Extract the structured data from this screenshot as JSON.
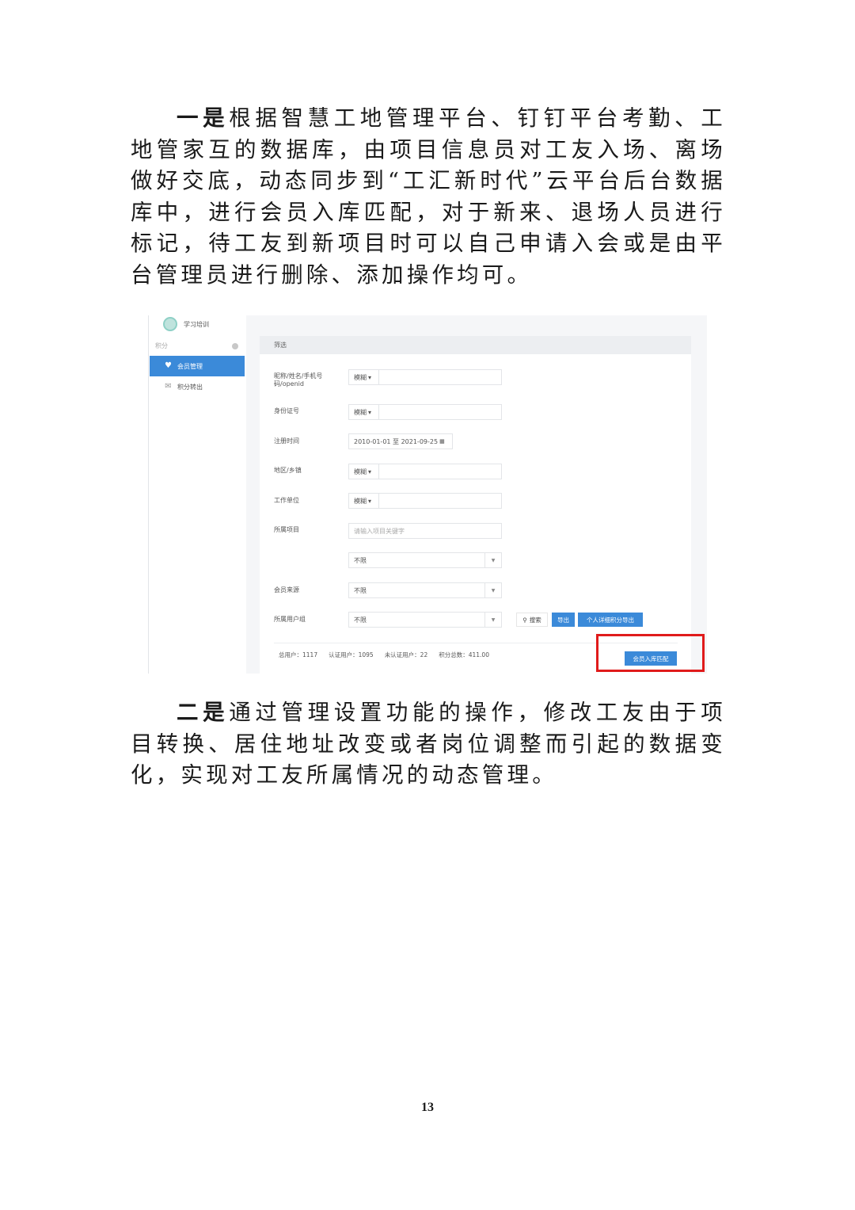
{
  "paragraphs": {
    "p1_lead": "一是",
    "p1_text": "根据智慧工地管理平台、钉钉平台考勤、工地管家互的数据库，由项目信息员对工友入场、离场做好交底，动态同步到“工汇新时代”云平台后台数据库中，进行会员入库匹配，对于新来、退场人员进行标记，待工友到新项目时可以自己申请入会或是由平台管理员进行删除、添加操作均可。",
    "p2_lead": "二是",
    "p2_text": "通过管理设置功能的操作，修改工友由于项目转换、居住地址改变或者岗位调整而引起的数据变化，实现对工友所属情况的动态管理。"
  },
  "screenshot": {
    "sidebar": {
      "top_label": "学习培训",
      "section_label": "积分",
      "items": [
        {
          "label": "会员管理",
          "icon": "heart-icon"
        },
        {
          "label": "积分转出",
          "icon": "mail-icon"
        }
      ]
    },
    "panel_title": "筛选",
    "filters": {
      "name_label": "昵称/姓名/手机号码/openid",
      "name_mode": "模糊",
      "id_label": "身份证号",
      "id_mode": "模糊",
      "reg_label": "注册时间",
      "reg_value": "2010-01-01 至 2021-09-25",
      "area_label": "地区/乡镇",
      "area_mode": "模糊",
      "work_label": "工作单位",
      "work_mode": "模糊",
      "project_label": "所属项目",
      "project_placeholder": "请输入项目关键字",
      "project_select": "不限",
      "source_label": "会员来源",
      "source_select": "不限",
      "group_label": "所属用户组",
      "group_select": "不限"
    },
    "buttons": {
      "search": "搜索",
      "export": "导出",
      "detail_export": "个人详细积分导出",
      "match": "会员入库匹配"
    },
    "stats": {
      "total": "总用户：1117",
      "verified": "认证用户：1095",
      "unverified": "未认证用户：22",
      "points": "积分总数：411.00"
    },
    "colors": {
      "primary": "#3b8ad9",
      "highlight": "#e01b1b"
    }
  },
  "page_number": "13"
}
